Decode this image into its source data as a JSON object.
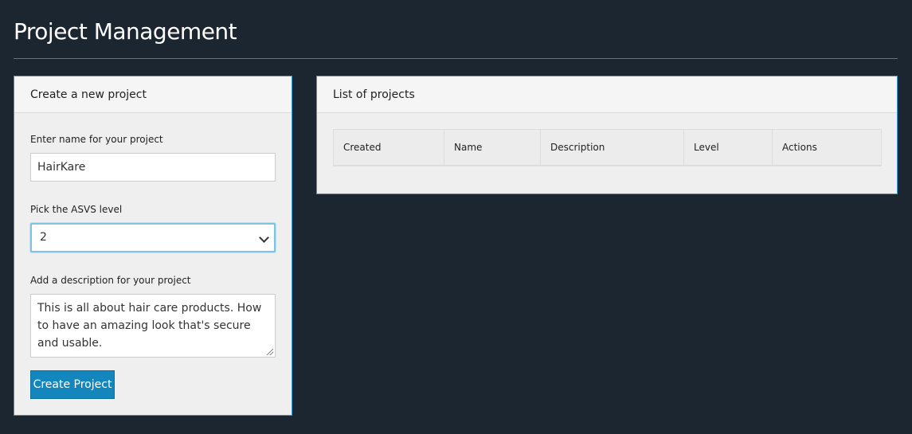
{
  "page": {
    "title": "Project Management"
  },
  "create_panel": {
    "header": "Create a new project",
    "name_label": "Enter name for your project",
    "name_value": "HairKare",
    "level_label": "Pick the ASVS level",
    "level_value": "2",
    "description_label": "Add a description for your project",
    "description_value": "This is all about hair care products. How to have an amazing look that's secure and usable.",
    "submit_label": "Create Project"
  },
  "list_panel": {
    "header": "List of projects",
    "columns": [
      "Created",
      "Name",
      "Description",
      "Level",
      "Actions"
    ]
  },
  "colors": {
    "background": "#1c2631",
    "accent": "#2e9bd6",
    "button": "#1387bd"
  }
}
